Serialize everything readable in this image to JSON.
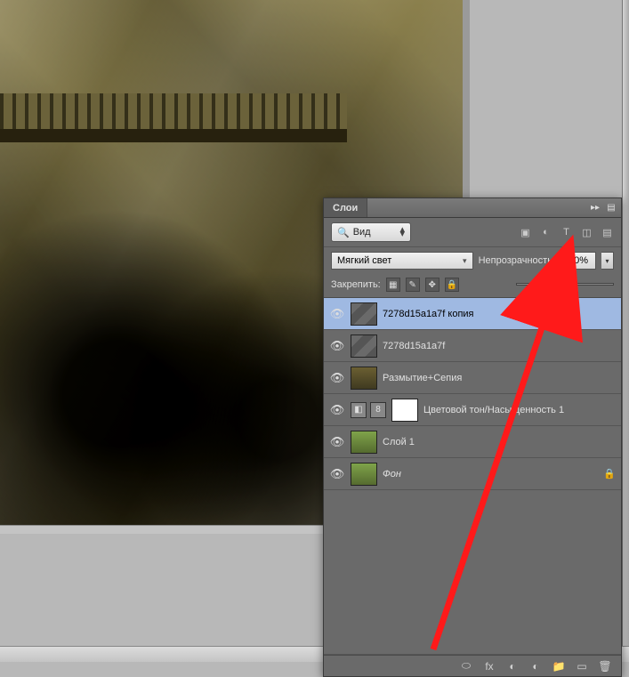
{
  "panel": {
    "title": "Слои",
    "filter_type": "Вид",
    "blend_mode": "Мягкий свет",
    "opacity_label": "Непрозрачность:",
    "opacity_value": "50%",
    "lock_label": "Закрепить:",
    "slider_percent": 50
  },
  "layers": [
    {
      "name": "7278d15a1a7f копия",
      "selected": true,
      "thumb": "texture",
      "locked": false,
      "adj": false,
      "italic": false
    },
    {
      "name": "7278d15a1a7f",
      "selected": false,
      "thumb": "texture",
      "locked": false,
      "adj": false,
      "italic": false
    },
    {
      "name": "Размытие+Сепия",
      "selected": false,
      "thumb": "sepia",
      "locked": false,
      "adj": false,
      "italic": false
    },
    {
      "name": "Цветовой тон/Насыщенность 1",
      "selected": false,
      "thumb": "white",
      "locked": false,
      "adj": true,
      "italic": false
    },
    {
      "name": "Слой 1",
      "selected": false,
      "thumb": "color",
      "locked": false,
      "adj": false,
      "italic": false
    },
    {
      "name": "Фон",
      "selected": false,
      "thumb": "color",
      "locked": true,
      "adj": false,
      "italic": true
    }
  ],
  "icons": {
    "eye": "👁",
    "lock": "🔒",
    "pixels": "▦",
    "brush": "✎",
    "move": "✥",
    "image": "▣",
    "adjust": "◐",
    "text": "T",
    "path": "◫",
    "smart": "▤",
    "link": "⬭",
    "fx": "fx",
    "mask": "◐",
    "folder": "📁",
    "new": "▭",
    "trash": "🗑",
    "collapse_l": "▸▸",
    "menu": "▤"
  }
}
